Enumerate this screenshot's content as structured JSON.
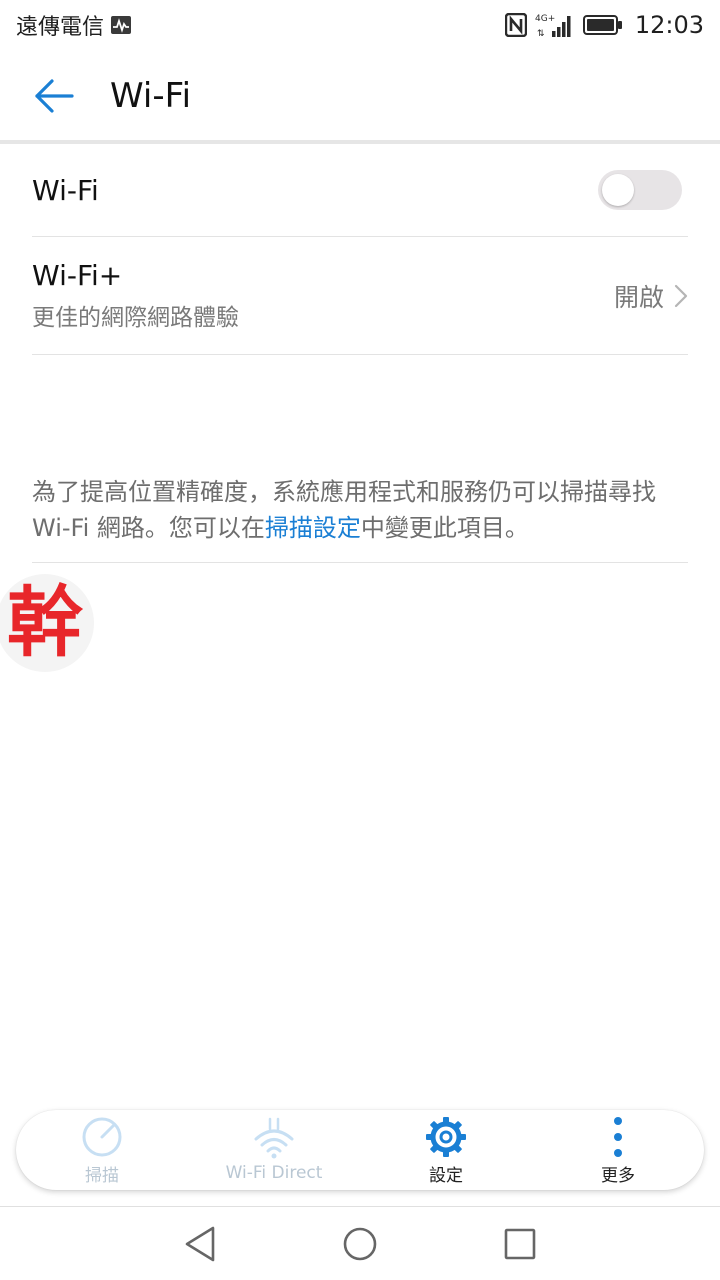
{
  "status_bar": {
    "carrier": "遠傳電信",
    "network": "4G+",
    "time": "12:03",
    "icons": [
      "activity-icon",
      "nfc-icon",
      "signal-icon",
      "battery-icon"
    ]
  },
  "app_bar": {
    "title": "Wi-Fi",
    "back_icon": "arrow-left-icon"
  },
  "settings": {
    "wifi": {
      "label": "Wi-Fi",
      "enabled": false
    },
    "wifi_plus": {
      "label": "Wi-Fi+",
      "subtitle": "更佳的網際網路體驗",
      "value": "開啟"
    }
  },
  "info": {
    "text_before": "為了提高位置精確度，系統應用程式和服務仍可以掃描尋找 Wi-Fi 網路。您可以在",
    "link": "掃描設定",
    "text_after": "中變更此項目。"
  },
  "floating_badge": {
    "char": "幹"
  },
  "actions": [
    {
      "label": "掃描",
      "icon": "scan-icon",
      "enabled": false
    },
    {
      "label": "Wi-Fi Direct",
      "icon": "wifi-direct-icon",
      "enabled": false
    },
    {
      "label": "設定",
      "icon": "gear-icon",
      "enabled": true
    },
    {
      "label": "更多",
      "icon": "more-vertical-icon",
      "enabled": true
    }
  ],
  "colors": {
    "accent": "#1a7fd4",
    "disabled_icon": "#c7dff3",
    "disabled_text": "#b9c7d3",
    "toggle_off": "#e7e4e6",
    "badge_red": "#e8262a"
  }
}
